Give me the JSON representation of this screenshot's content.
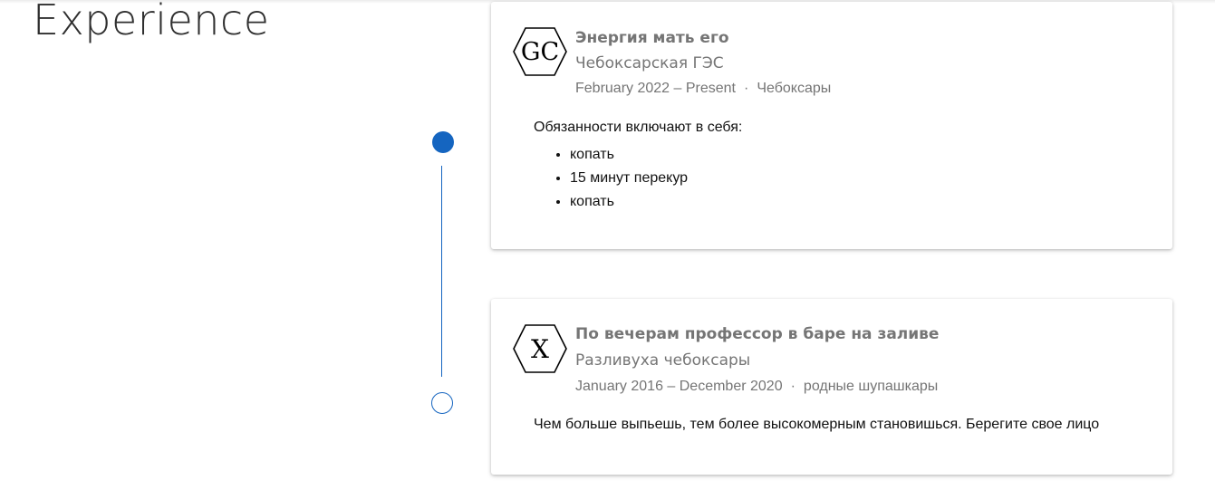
{
  "section": {
    "title": "Experience"
  },
  "timeline": {
    "accent_color": "#1565c0"
  },
  "jobs": [
    {
      "logo_text": "GC",
      "title": "Энергия мать его",
      "company": "Чебоксарская ГЭС",
      "dates": "February 2022 – Present",
      "separator": "·",
      "location": "Чебоксары",
      "description": "Обязанности включают в себя:",
      "duties": [
        "копать",
        "15 минут перекур",
        "копать"
      ]
    },
    {
      "logo_text": "X",
      "title": "По вечерам профессор в баре на заливе",
      "company": "Разливуха чебоксары",
      "dates": "January 2016 – December 2020",
      "separator": "·",
      "location": "родные шупашкары",
      "description": "Чем больше выпьешь, тем более высокомерным становишься. Берегите свое лицо"
    }
  ]
}
